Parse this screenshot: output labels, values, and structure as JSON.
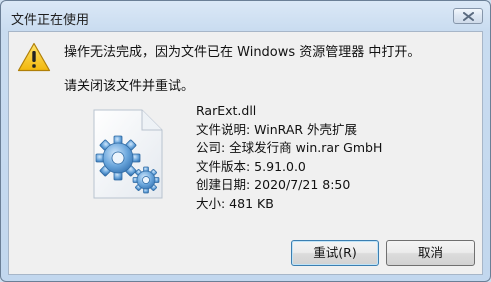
{
  "window": {
    "title": "文件正在使用"
  },
  "message": {
    "line1": "操作无法完成，因为文件已在 Windows 资源管理器 中打开。",
    "line2": "请关闭该文件并重试。"
  },
  "file": {
    "name": "RarExt.dll",
    "description": "文件说明: WinRAR 外壳扩展",
    "company": "公司: 全球发行商 win.rar GmbH",
    "version": "文件版本: 5.91.0.0",
    "created": "创建日期: 2020/7/21 8:50",
    "size": "大小: 481 KB"
  },
  "buttons": {
    "retry": "重试(R)",
    "cancel": "取消"
  },
  "icons": {
    "warning": "warning-triangle-icon",
    "file": "dll-settings-file-icon",
    "close": "close-x-icon"
  },
  "colors": {
    "warning_fill": "#f5c518",
    "default_button_border": "#3c7fb1",
    "gear": "#5b9bd5"
  }
}
